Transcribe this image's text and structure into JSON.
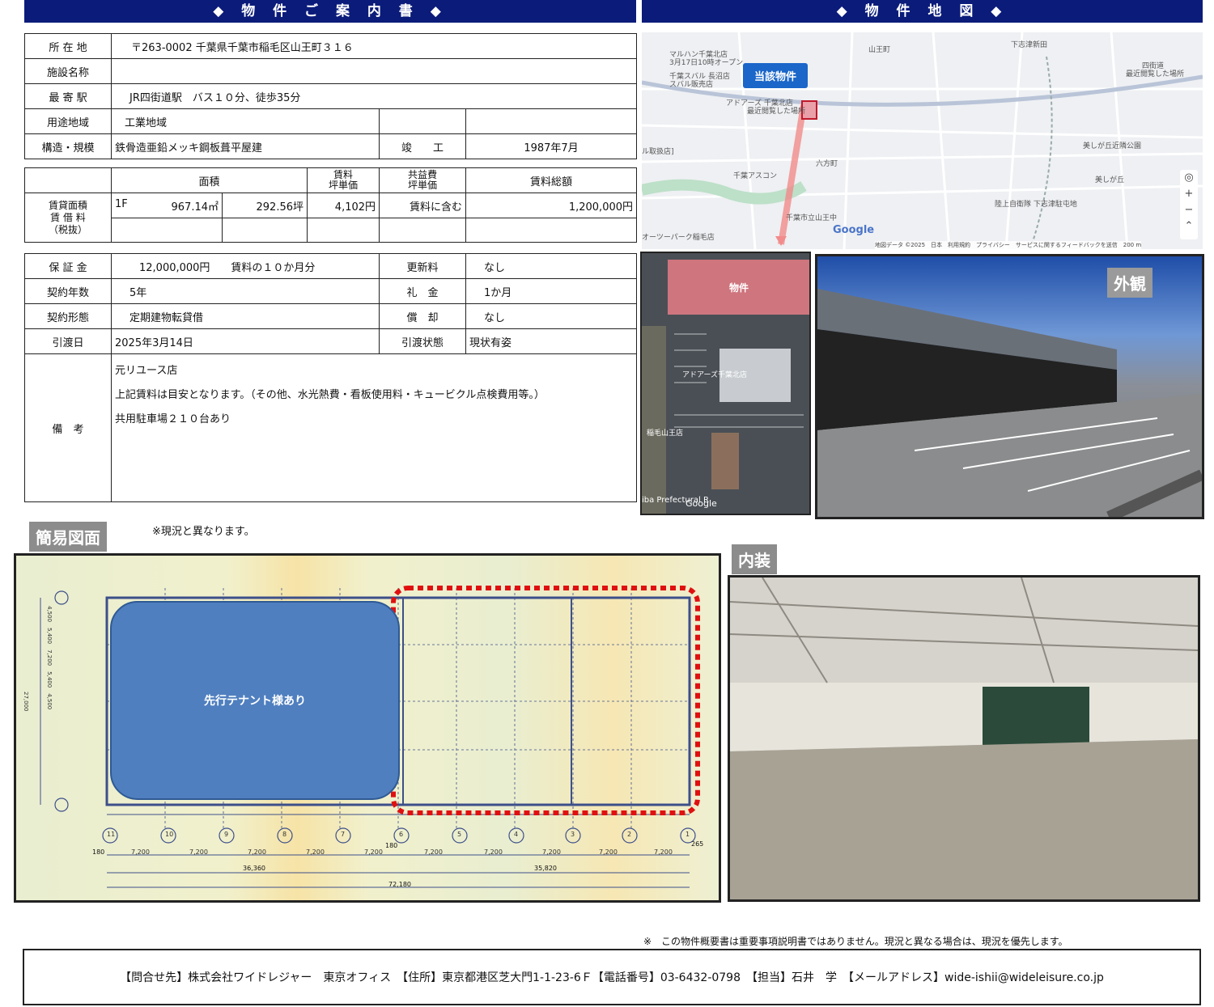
{
  "headers": {
    "left": "◆ 物 件 ご 案 内 書 ◆",
    "right": "◆ 物 件 地 図 ◆"
  },
  "info": {
    "address_label": "所 在 地",
    "address": "〒263-0002 千葉県千葉市稲毛区山王町３１６",
    "facility_label": "施設名称",
    "facility": "",
    "station_label": "最 寄 駅",
    "station": "JR四街道駅　バス１０分、徒歩35分",
    "zoning_label": "用途地域",
    "zoning": "工業地域",
    "structure_label": "構造・規模",
    "structure": "鉄骨造亜鉛メッキ鋼板葺平屋建",
    "completed_label": "竣　　工",
    "completed": "1987年7月"
  },
  "rent": {
    "headers": [
      "面積",
      "賃料\n坪単価",
      "共益費\n坪単価",
      "賃料総額"
    ],
    "row_label": "賃貸面積\n賃 借 料\n（税抜）",
    "floor": "1F",
    "area_m2": "967.14㎡",
    "area_tsubo": "292.56坪",
    "unit_rent": "4,102円",
    "common_fee": "賃料に含む",
    "total": "1,200,000円"
  },
  "contract": {
    "deposit_label": "保 証 金",
    "deposit": "12,000,000円　　賃料の１０か月分",
    "renewal_label": "更新料",
    "renewal": "なし",
    "term_label": "契約年数",
    "term": "5年",
    "key_money_label": "礼　金",
    "key_money": "1か月",
    "type_label": "契約形態",
    "type": "定期建物転貸借",
    "amortization_label": "償　却",
    "amortization": "なし",
    "handover_label": "引渡日",
    "handover": "2025年3月14日",
    "handover_state_label": "引渡状態",
    "handover_state": "現状有姿",
    "remarks_label": "備　考",
    "remarks": [
      "元リユース店",
      "上記賃料は目安となります。（その他、水光熱費・看板使用料・キュービクル点検費用等。）",
      "共用駐車場２１０台あり"
    ]
  },
  "map": {
    "marker": "当該物件",
    "places": [
      "マルハン千葉北店",
      "3月17日10時オープン",
      "千葉スバル 長沼店",
      "スバル販売店",
      "アドアーズ 千葉北店",
      "最近閲覧した場所",
      "山王町",
      "下志津新田",
      "四街道",
      "最近閲覧した場所",
      "六方町",
      "美しが丘近隣公園",
      "美しが丘",
      "千葉アスコン",
      "陸上自衛隊 下志津駐屯地",
      "千葉市立山王中",
      "オーツーパーク稲毛店",
      "ル取扱店]"
    ],
    "logo": "Google",
    "footer": "地図データ ©2025　日本　利用規約　プライバシー　サービスに関するフィードバックを送信　200 m"
  },
  "aerial": {
    "label": "物件",
    "places": [
      "アドアーズ千葉北店",
      "稲毛山王店"
    ],
    "logo": "Google",
    "road": "iba Prefectural R"
  },
  "exterior_label": "外観",
  "interior_label": "内装",
  "floorplan": {
    "title": "簡易図面",
    "note": "※現況と異なります。",
    "tenant_label": "先行テナント様あり",
    "dims": [
      "7,200",
      "7,200",
      "7,200",
      "7,200",
      "7,200",
      "7,200",
      "7,200",
      "7,200",
      "7,200",
      "7,200"
    ],
    "totals": [
      "36,360",
      "35,820",
      "72,180"
    ],
    "col_numbers": [
      "11",
      "10",
      "9",
      "8",
      "7",
      "6",
      "5",
      "4",
      "3",
      "2",
      "1"
    ],
    "edges": [
      "180",
      "180",
      "265"
    ],
    "row_dims": [
      "4,500",
      "5,400",
      "7,200",
      "5,400",
      "4,500"
    ],
    "total_depth": "27,000"
  },
  "disclaimer": "※　この物件概要書は重要事項説明書ではありません。現況と異なる場合は、現況を優先します。",
  "contact": "【問合せ先】株式会社ワイドレジャー　東京オフィス　【住所】東京都港区芝大門1-1-23-6Ｆ【電話番号】03-6432-0798　【担当】石井　学　【メールアドレス】wide-ishii@wideleisure.co.jp"
}
